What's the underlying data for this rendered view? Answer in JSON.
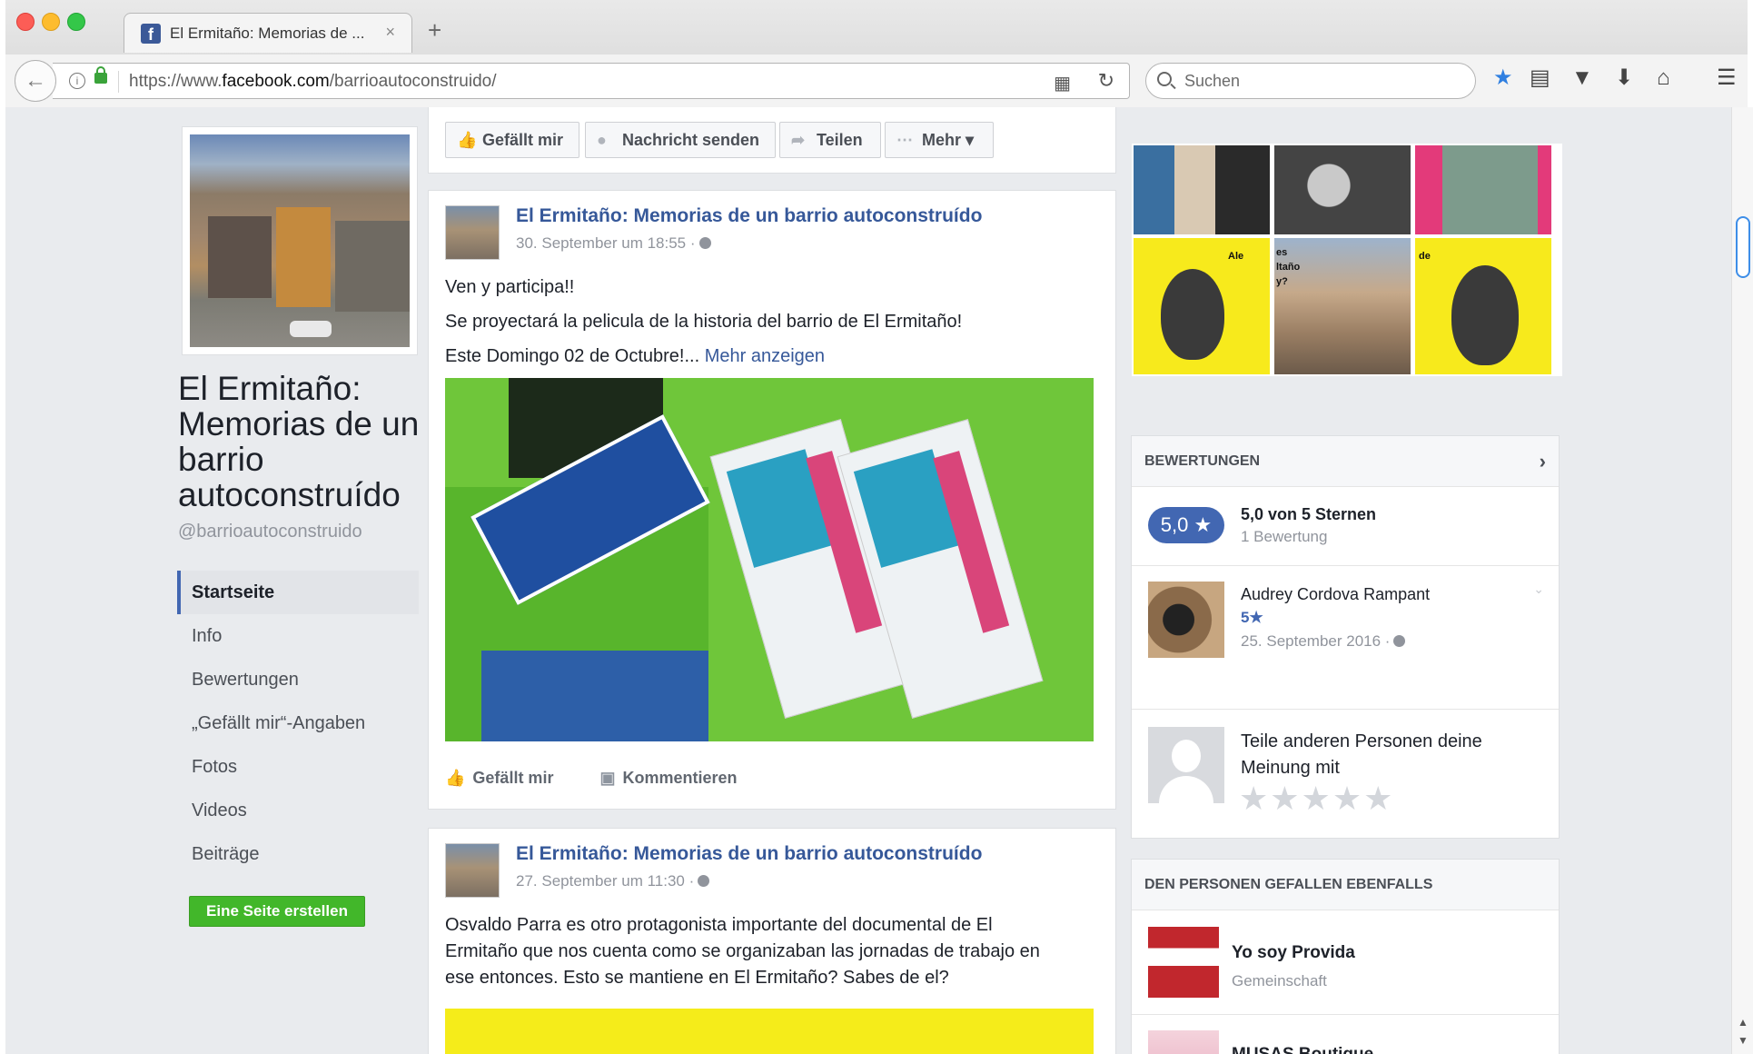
{
  "browser": {
    "tab_title": "El Ermitaño: Memorias de ...",
    "tab_close": "×",
    "new_tab": "+",
    "url_prefix": "https://www.",
    "url_domain": "facebook.com",
    "url_path": "/barrioautoconstruido/",
    "search_placeholder": "Suchen"
  },
  "page": {
    "title": "El Ermitaño: Memorias de un barrio autoconstruído",
    "handle": "@barrioautoconstruido",
    "nav": [
      {
        "label": "Startseite"
      },
      {
        "label": "Info"
      },
      {
        "label": "Bewertungen"
      },
      {
        "label": "„Gefällt mir“-Angaben"
      },
      {
        "label": "Fotos"
      },
      {
        "label": "Videos"
      },
      {
        "label": "Beiträge"
      }
    ],
    "create_page_button": "Eine Seite erstellen"
  },
  "action_bar": {
    "like": "Gefällt mir",
    "message": "Nachricht senden",
    "share": "Teilen",
    "more": "Mehr ▾"
  },
  "posts": [
    {
      "author": "El Ermitaño: Memorias de un barrio autoconstruído",
      "time": "30. September um 18:55 ·",
      "lines": [
        "Ven y participa!!",
        "Se proyectará la pelicula de la historia del barrio de El Ermitaño!",
        "Este Domingo 02 de Octubre!..."
      ],
      "more_link": "Mehr anzeigen",
      "like": "Gefällt mir",
      "comment": "Kommentieren"
    },
    {
      "author": "El Ermitaño: Memorias de un barrio autoconstruído",
      "time": "27. September um 11:30 ·",
      "lines": [
        "Osvaldo Parra es otro protagonista importante del documental de El",
        "Ermitaño que nos cuenta como se organizaban las jornadas de trabajo en",
        "ese entonces. Esto se mantiene en El Ermitaño? Sabes de el?"
      ]
    }
  ],
  "photo_labels": [
    "Ale",
    "es",
    "ltaño",
    "y?",
    "de"
  ],
  "reviews": {
    "header": "BEWERTUNGEN",
    "score": "5,0 ★",
    "score_text": "5,0 von 5 Sternen",
    "count": "1 Bewertung",
    "reviewer": "Audrey Cordova Rampant",
    "reviewer_stars": "5★",
    "review_date": "25. September 2016 ·",
    "share_prompt": "Teile anderen Personen deine Meinung mit",
    "empty_stars": "★★★★★"
  },
  "also_liked": {
    "header": "DEN PERSONEN GEFALLEN EBENFALLS",
    "items": [
      {
        "name": "Yo soy Provida",
        "category": "Gemeinschaft"
      },
      {
        "name": "MUSAS Boutique",
        "category": ""
      }
    ]
  },
  "colors": {
    "facebook_blue": "#4267b2",
    "link_blue": "#365899",
    "green_button": "#42b72a",
    "page_bg": "#e9ebee"
  }
}
